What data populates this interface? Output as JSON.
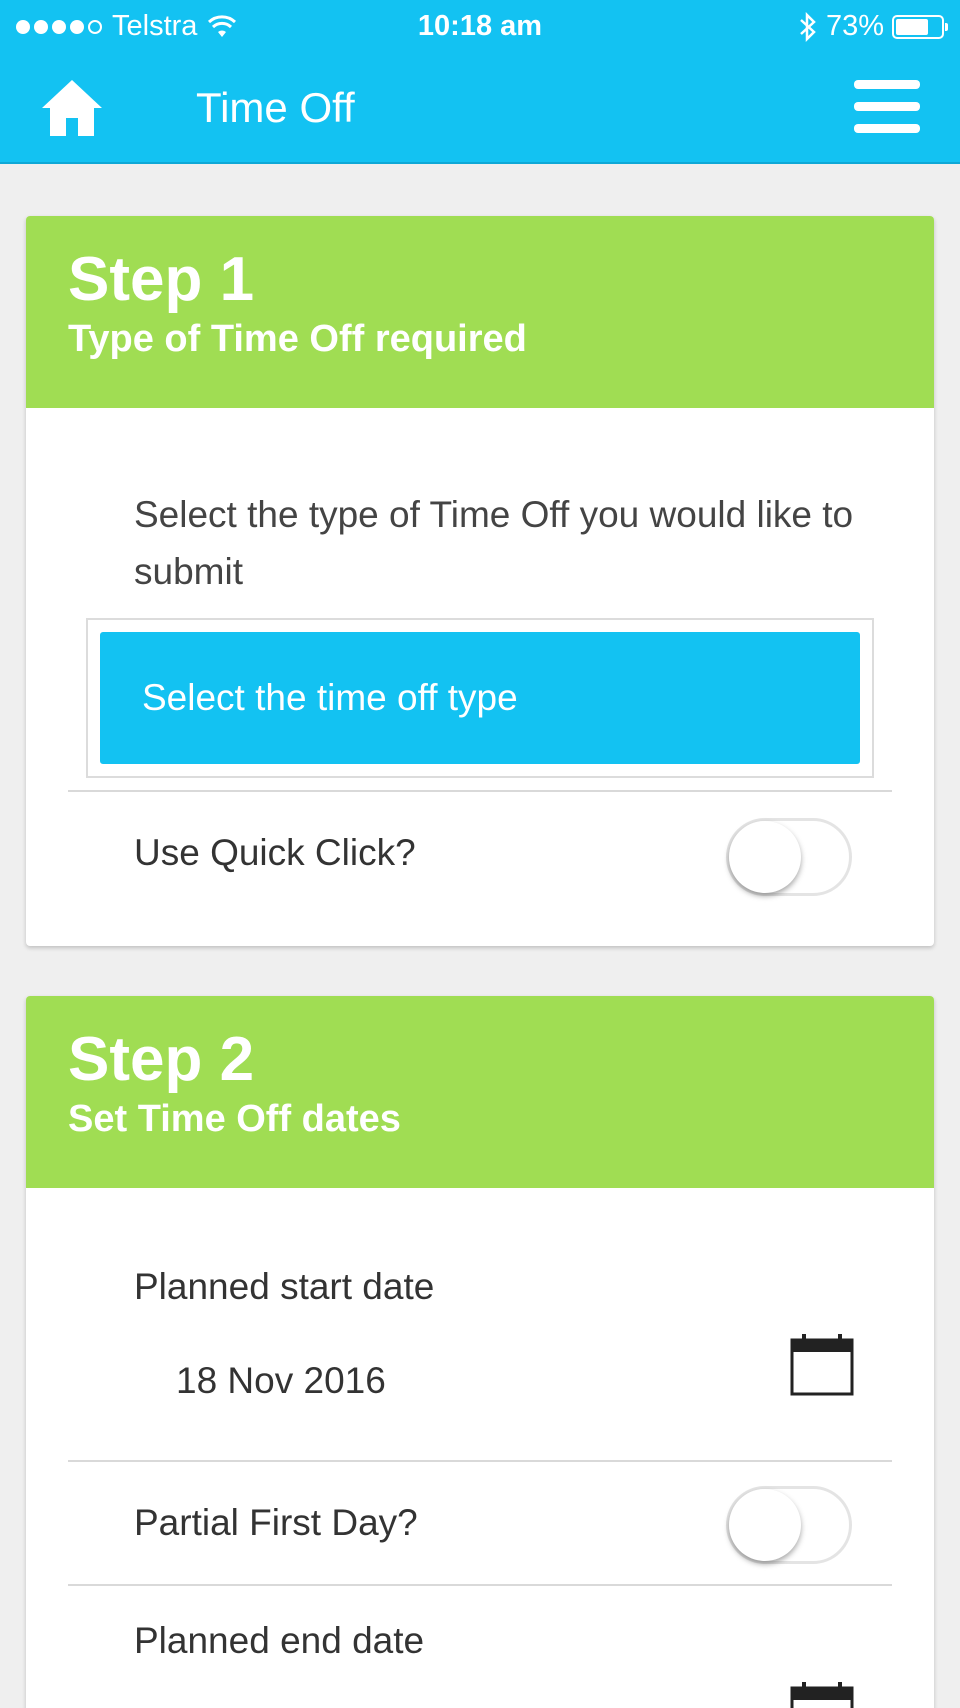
{
  "status": {
    "carrier": "Telstra",
    "signal_bars": 4,
    "time": "10:18 am",
    "battery": "73%",
    "battery_level": 0.73
  },
  "nav": {
    "title": "Time Off",
    "home_icon": "home-icon",
    "menu_icon": "hamburger-menu-icon"
  },
  "step1": {
    "title": "Step 1",
    "subtitle": "Type of Time Off required",
    "prompt": "Select the type of Time Off you would like to submit",
    "select_label": "Select the time off type",
    "quick_click_label": "Use Quick Click?",
    "quick_click_on": false
  },
  "step2": {
    "title": "Step 2",
    "subtitle": "Set Time Off dates",
    "start_label": "Planned start date",
    "start_value": "18 Nov 2016",
    "partial_first_label": "Partial First Day?",
    "partial_first_on": false,
    "end_label": "Planned end date"
  },
  "colors": {
    "primary": "#13c2f2",
    "step_header": "#a0dd53",
    "background": "#efefef"
  }
}
